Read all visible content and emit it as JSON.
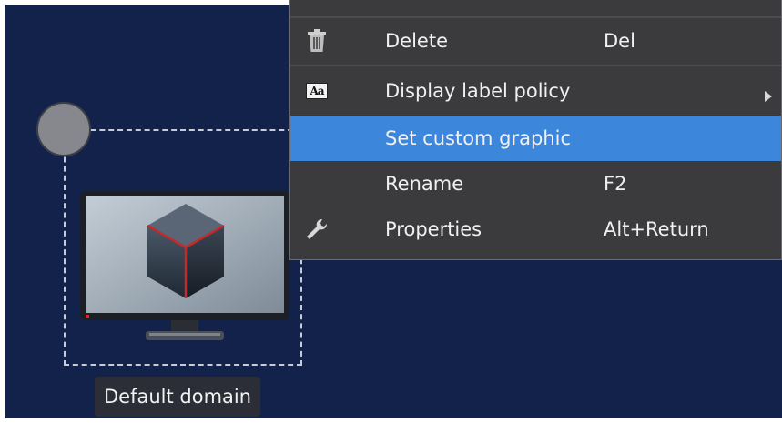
{
  "canvas": {
    "background": "#13224a",
    "node": {
      "label": "Default domain",
      "icon": "monitor-with-cube-icon",
      "handle_icon": "circle-handle"
    }
  },
  "context_menu": {
    "items": [
      {
        "label": "Delete",
        "shortcut": "Del",
        "icon": "trash-icon"
      },
      {
        "label": "Display label policy",
        "shortcut": "",
        "icon": "font-aa-icon",
        "submenu": true
      },
      {
        "label": "Set custom graphic",
        "shortcut": "",
        "icon": "",
        "highlighted": true
      },
      {
        "label": "Rename",
        "shortcut": "F2",
        "icon": ""
      },
      {
        "label": "Properties",
        "shortcut": "Alt+Return",
        "icon": "wrench-icon"
      }
    ],
    "highlight_color": "#3c86dc",
    "aa_icon_text": "Aa"
  }
}
